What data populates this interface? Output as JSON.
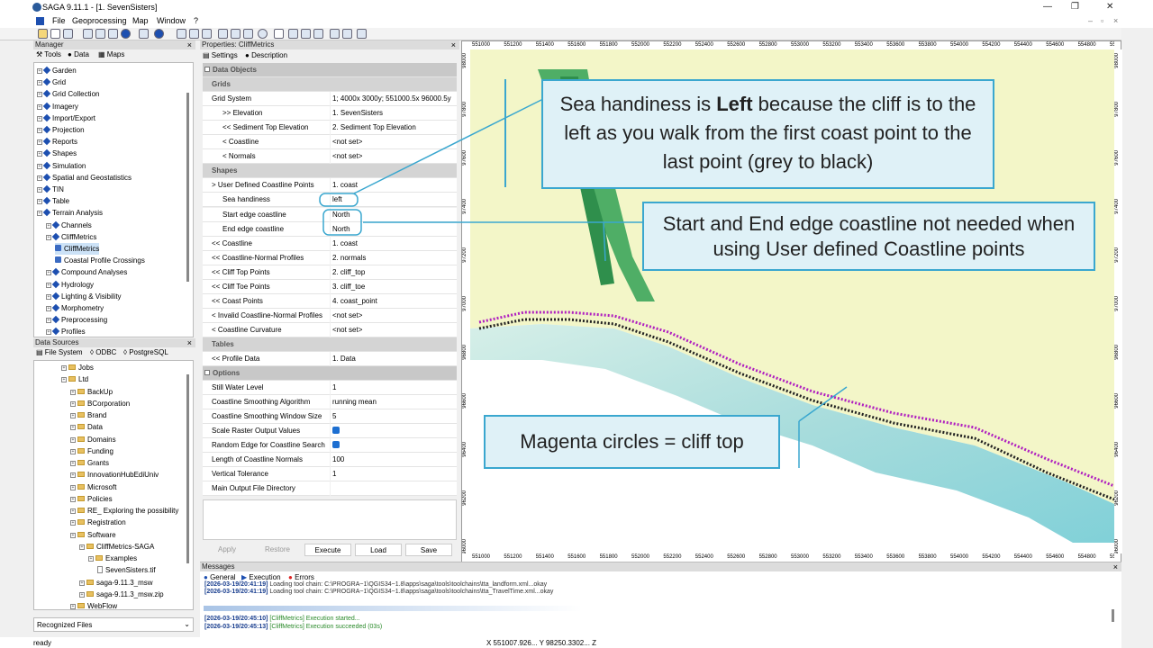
{
  "window": {
    "title": "SAGA 9.11.1 - [1. SevenSisters]"
  },
  "menu": [
    "File",
    "Geoprocessing",
    "Map",
    "Window",
    "?"
  ],
  "manager": {
    "title": "Manager",
    "tabs": [
      "Tools",
      "Data",
      "Maps"
    ],
    "items": [
      {
        "label": "Garden",
        "level": 0
      },
      {
        "label": "Grid",
        "level": 0
      },
      {
        "label": "Grid Collection",
        "level": 0
      },
      {
        "label": "Imagery",
        "level": 0
      },
      {
        "label": "Import/Export",
        "level": 0
      },
      {
        "label": "Projection",
        "level": 0
      },
      {
        "label": "Reports",
        "level": 0
      },
      {
        "label": "Shapes",
        "level": 0
      },
      {
        "label": "Simulation",
        "level": 0
      },
      {
        "label": "Spatial and Geostatistics",
        "level": 0
      },
      {
        "label": "TIN",
        "level": 0
      },
      {
        "label": "Table",
        "level": 0
      },
      {
        "label": "Terrain Analysis",
        "level": 0
      },
      {
        "label": "Channels",
        "level": 1
      },
      {
        "label": "CliffMetrics",
        "level": 1
      },
      {
        "label": "CliffMetrics",
        "level": 2
      },
      {
        "label": "Coastal Profile Crossings",
        "level": 2
      },
      {
        "label": "Compound Analyses",
        "level": 1
      },
      {
        "label": "Hydrology",
        "level": 1
      },
      {
        "label": "Lighting & Visibility",
        "level": 1
      },
      {
        "label": "Morphometry",
        "level": 1
      },
      {
        "label": "Preprocessing",
        "level": 1
      },
      {
        "label": "Profiles",
        "level": 1
      }
    ]
  },
  "datasources": {
    "title": "Data Sources",
    "tabs": [
      "File System",
      "ODBC",
      "PostgreSQL"
    ],
    "items": [
      {
        "label": "Jobs",
        "level": 0
      },
      {
        "label": "Ltd",
        "level": 0
      },
      {
        "label": "BackUp",
        "level": 1
      },
      {
        "label": "BCorporation",
        "level": 1
      },
      {
        "label": "Brand",
        "level": 1
      },
      {
        "label": "Data",
        "level": 1
      },
      {
        "label": "Domains",
        "level": 1
      },
      {
        "label": "Funding",
        "level": 1
      },
      {
        "label": "Grants",
        "level": 1
      },
      {
        "label": "InnovationHubEdiUniv",
        "level": 1
      },
      {
        "label": "Microsoft",
        "level": 1
      },
      {
        "label": "Policies",
        "level": 1
      },
      {
        "label": "RE_ Exploring the possibility",
        "level": 1
      },
      {
        "label": "Registration",
        "level": 1
      },
      {
        "label": "Software",
        "level": 1
      },
      {
        "label": "CliffMetrics-SAGA",
        "level": 2
      },
      {
        "label": "Examples",
        "level": 3
      },
      {
        "label": "SevenSisters.tif",
        "level": 4
      },
      {
        "label": "saga-9.11.3_msw",
        "level": 2
      },
      {
        "label": "saga-9.11.3_msw.zip",
        "level": 2
      },
      {
        "label": "WebFlow",
        "level": 1
      }
    ],
    "footer": "Recognized Files"
  },
  "properties": {
    "title": "Properties: CliffMetrics",
    "tabs": [
      "Settings",
      "Description"
    ],
    "rows": [
      {
        "k": "Data Objects",
        "v": "",
        "t": "cat"
      },
      {
        "k": "Grids",
        "v": "",
        "t": "cat2"
      },
      {
        "k": "Grid System",
        "v": "1; 4000x 3000y; 551000.5x 96000.5y"
      },
      {
        "k": ">> Elevation",
        "v": "1. SevenSisters",
        "i": 1
      },
      {
        "k": "<< Sediment Top Elevation",
        "v": "2. Sediment Top Elevation",
        "i": 1
      },
      {
        "k": "< Coastline",
        "v": "<not set>",
        "i": 1
      },
      {
        "k": "< Normals",
        "v": "<not set>",
        "i": 1
      },
      {
        "k": "Shapes",
        "v": "",
        "t": "cat2"
      },
      {
        "k": "> User Defined Coastline Points",
        "v": "1. coast"
      },
      {
        "k": "Sea handiness",
        "v": "left",
        "i": 1
      },
      {
        "k": "Start edge coastline",
        "v": "North",
        "i": 1
      },
      {
        "k": "End edge coastline",
        "v": "North",
        "i": 1
      },
      {
        "k": "<< Coastline",
        "v": "1. coast"
      },
      {
        "k": "<< Coastline-Normal Profiles",
        "v": "2. normals"
      },
      {
        "k": "<< Cliff Top Points",
        "v": "2. cliff_top"
      },
      {
        "k": "<< Cliff Toe Points",
        "v": "3. cliff_toe"
      },
      {
        "k": "<< Coast Points",
        "v": "4. coast_point"
      },
      {
        "k": "< Invalid Coastline-Normal Profiles",
        "v": "<not set>"
      },
      {
        "k": "< Coastline Curvature",
        "v": "<not set>"
      },
      {
        "k": "Tables",
        "v": "",
        "t": "cat2"
      },
      {
        "k": "<< Profile Data",
        "v": "1. Data"
      },
      {
        "k": "Options",
        "v": "",
        "t": "cat"
      },
      {
        "k": "Still Water Level",
        "v": "1"
      },
      {
        "k": "Coastline Smoothing Algorithm",
        "v": "running mean"
      },
      {
        "k": "Coastline Smoothing Window Size",
        "v": "5"
      },
      {
        "k": "Scale Raster Output Values",
        "v": "",
        "c": 1
      },
      {
        "k": "Random Edge for Coastline Search",
        "v": "",
        "c": 1
      },
      {
        "k": "Length of Coastline Normals",
        "v": "100"
      },
      {
        "k": "Vertical Tolerance",
        "v": "1"
      },
      {
        "k": "Main Output File Directory",
        "v": ""
      }
    ],
    "buttons": [
      "Apply",
      "Restore",
      "Execute",
      "Load",
      "Save"
    ]
  },
  "map": {
    "xticks": [
      "551000",
      "551200",
      "551400",
      "551600",
      "551800",
      "552000",
      "552200",
      "552400",
      "552600",
      "552800",
      "553000",
      "553200",
      "553400",
      "553600",
      "553800",
      "554000",
      "554200",
      "554400",
      "554600",
      "554800",
      "555"
    ],
    "yticks": [
      "98000",
      "97800",
      "97600",
      "97400",
      "97200",
      "97000",
      "96800",
      "96600",
      "96400",
      "96200",
      "96000"
    ]
  },
  "callouts": {
    "sea": {
      "pre": "Sea handiness is ",
      "bold": "Left",
      "post": " because the cliff is to the left as you walk from the first coast point to the last point (grey to black)"
    },
    "edge": "Start and End edge coastline not needed when using User defined Coastline points",
    "magenta": "Magenta circles = cliff top"
  },
  "messages": {
    "title": "Messages",
    "tabs": [
      "General",
      "Execution",
      "Errors"
    ],
    "lines": [
      {
        "ts": "[2026-03-19/20:41:19]",
        "msg": "Loading tool chain: C:\\PROGRA~1\\QGIS34~1.8\\apps\\saga\\tools\\toolchains\\tta_landform.xml...okay"
      },
      {
        "ts": "[2026-03-19/20:41:19]",
        "msg": "Loading tool chain: C:\\PROGRA~1\\QGIS34~1.8\\apps\\saga\\tools\\toolchains\\tta_TravelTime.xml...okay"
      },
      {
        "ts": "[2026-03-19/20:45:10]",
        "msg": "[CliffMetrics] Execution started..."
      },
      {
        "ts": "[2026-03-19/20:45:13]",
        "msg": "[CliffMetrics] Execution succeeded (03s)"
      }
    ]
  },
  "status": {
    "left": "ready",
    "coords": "X 551007.926...  Y 98250.3302...  Z"
  }
}
